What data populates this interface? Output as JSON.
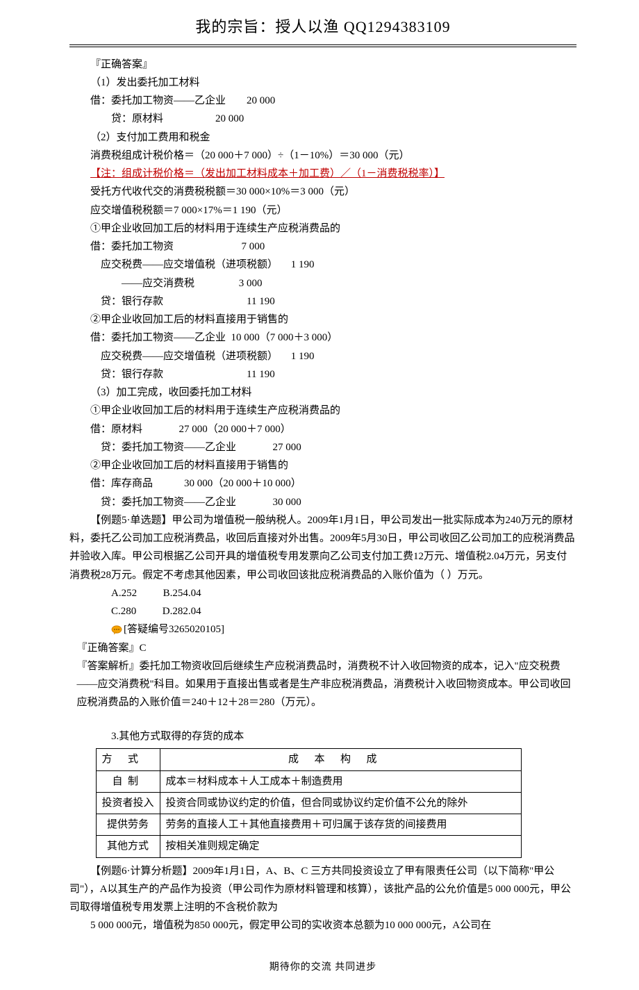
{
  "header": {
    "title": "我的宗旨：授人以渔  QQ1294383109"
  },
  "footer": "期待你的交流 共同进步",
  "lines": {
    "l1": "『正确答案』",
    "l2": "（1）发出委托加工材料",
    "l3": "借：委托加工物资——乙企业        20 000",
    "l4": "贷：原材料                    20 000",
    "l5": "（2）支付加工费用和税金",
    "l6": "消费税组成计税价格＝（20 000＋7 000）÷（1－10%）＝30 000（元）",
    "l7": "【注：组成计税价格＝（发出加工材料成本＋加工费）／（1－消费税税率）】",
    "l8": "受托方代收代交的消费税税额＝30 000×10%＝3 000（元）",
    "l9": "应交增值税税额＝7 000×17%＝1 190（元）",
    "l10": "①甲企业收回加工后的材料用于连续生产应税消费品的",
    "l11": "借：委托加工物资                          7 000",
    "l12": "    应交税费——应交增值税（进项税额）     1 190",
    "l13": "            ——应交消费税                 3 000",
    "l14": "    贷：银行存款                                11 190",
    "l15": "②甲企业收回加工后的材料直接用于销售的",
    "l16": "借：委托加工物资——乙企业  10 000（7 000＋3 000）",
    "l17": "    应交税费——应交增值税（进项税额）     1 190",
    "l18": "    贷：银行存款                                11 190",
    "l19": "（3）加工完成，收回委托加工材料",
    "l20": "①甲企业收回加工后的材料用于连续生产应税消费品的",
    "l21": "借：原材料              27 000（20 000＋7 000）",
    "l22": "    贷：委托加工物资——乙企业              27 000",
    "l23": "②甲企业收回加工后的材料直接用于销售的",
    "l24": "借：库存商品            30 000（20 000＋10 000）",
    "l25": "    贷：委托加工物资——乙企业              30 000"
  },
  "question5": {
    "text": "【例题5·单选题】甲公司为增值税一般纳税人。2009年1月1日，甲公司发出一批实际成本为240万元的原材料，委托乙公司加工应税消费品，收回后直接对外出售。2009年5月30日，甲公司收回乙公司加工的应税消费品并验收入库。甲公司根据乙公司开具的增值税专用发票向乙公司支付加工费12万元、增值税2.04万元，另支付消费税28万元。假定不考虑其他因素，甲公司收回该批应税消费品的入账价值为（  ）万元。",
    "optA": "A.252",
    "optB": "B.254.04",
    "optC": "C.280",
    "optD": "D.282.04",
    "answerCode": "[答疑编号3265020105]",
    "correct": "『正确答案』C",
    "explanation": "『答案解析』委托加工物资收回后继续生产应税消费品时，消费税不计入收回物资的成本，记入\"应交税费——应交消费税\"科目。如果用于直接出售或者是生产非应税消费品，消费税计入收回物资成本。甲公司收回应税消费品的入账价值＝240＋12＋28＝280（万元）。"
  },
  "section3": {
    "title": "3.其他方式取得的存货的成本",
    "table": {
      "header": {
        "c1": "方式",
        "c2": "成本构成"
      },
      "rows": [
        {
          "method": "自制",
          "content": "成本＝材料成本＋人工成本＋制造费用"
        },
        {
          "method": "投资者投入",
          "content": "投资合同或协议约定的价值，但合同或协议约定价值不公允的除外"
        },
        {
          "method": "提供劳务",
          "content": "劳务的直接人工＋其他直接费用＋可归属于该存货的间接费用"
        },
        {
          "method": "其他方式",
          "content": "按相关准则规定确定"
        }
      ]
    }
  },
  "question6": {
    "p1": "【例题6·计算分析题】2009年1月1日，A、B、C 三方共同投资设立了甲有限责任公司（以下简称\"甲公司\"），A以其生产的产品作为投资（甲公司作为原材料管理和核算），该批产品的公允价值是5 000 000元，甲公司取得增值税专用发票上注明的不含税价款为",
    "p2": "5 000 000元，增值税为850 000元，假定甲公司的实收资本总额为10 000 000元，A公司在"
  }
}
